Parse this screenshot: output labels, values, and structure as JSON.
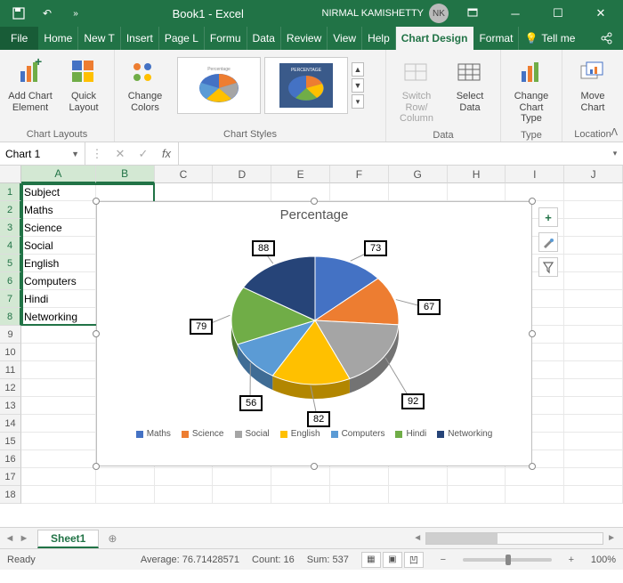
{
  "titlebar": {
    "doc": "Book1  -  Excel",
    "user": "NIRMAL KAMISHETTY",
    "initials": "NK"
  },
  "tabs": [
    "File",
    "Home",
    "New T",
    "Insert",
    "Page L",
    "Formu",
    "Data",
    "Review",
    "View",
    "Help",
    "Chart Design",
    "Format"
  ],
  "active_tab": "Chart Design",
  "tellme": "Tell me",
  "ribbon": {
    "add_chart_element": "Add Chart Element",
    "quick_layout": "Quick Layout",
    "change_colors": "Change Colors",
    "switch_rc": "Switch Row/ Column",
    "select_data": "Select Data",
    "change_type": "Change Chart Type",
    "move_chart": "Move Chart",
    "grp_layouts": "Chart Layouts",
    "grp_styles": "Chart Styles",
    "grp_data": "Data",
    "grp_type": "Type",
    "grp_location": "Location"
  },
  "namebox": "Chart 1",
  "fx": "",
  "columns": [
    "A",
    "B",
    "C",
    "D",
    "E",
    "F",
    "G",
    "H",
    "I",
    "J"
  ],
  "rows_visible": 18,
  "cells": {
    "A1": "Subject",
    "A2": "Maths",
    "A3": "Science",
    "A4": "Social",
    "A5": "English",
    "A6": "Computers",
    "A7": "Hindi",
    "A8": "Networking"
  },
  "sheet_tabs": {
    "active": "Sheet1"
  },
  "status": {
    "ready": "Ready",
    "avg_label": "Average:",
    "avg": "76.71428571",
    "count_label": "Count:",
    "count": "16",
    "sum_label": "Sum:",
    "sum": "537",
    "zoom": "100%"
  },
  "chart_side_plus": "+",
  "chart_data": {
    "type": "pie",
    "title": "Percentage",
    "series_name": "Percentage",
    "categories": [
      "Maths",
      "Science",
      "Social",
      "English",
      "Computers",
      "Hindi",
      "Networking"
    ],
    "values": [
      73,
      67,
      92,
      82,
      56,
      79,
      88
    ],
    "colors": [
      "#4472c4",
      "#ed7d31",
      "#a5a5a5",
      "#ffc000",
      "#5b9bd5",
      "#70ad47",
      "#264478"
    ],
    "legend_position": "bottom",
    "is_3d": true
  }
}
